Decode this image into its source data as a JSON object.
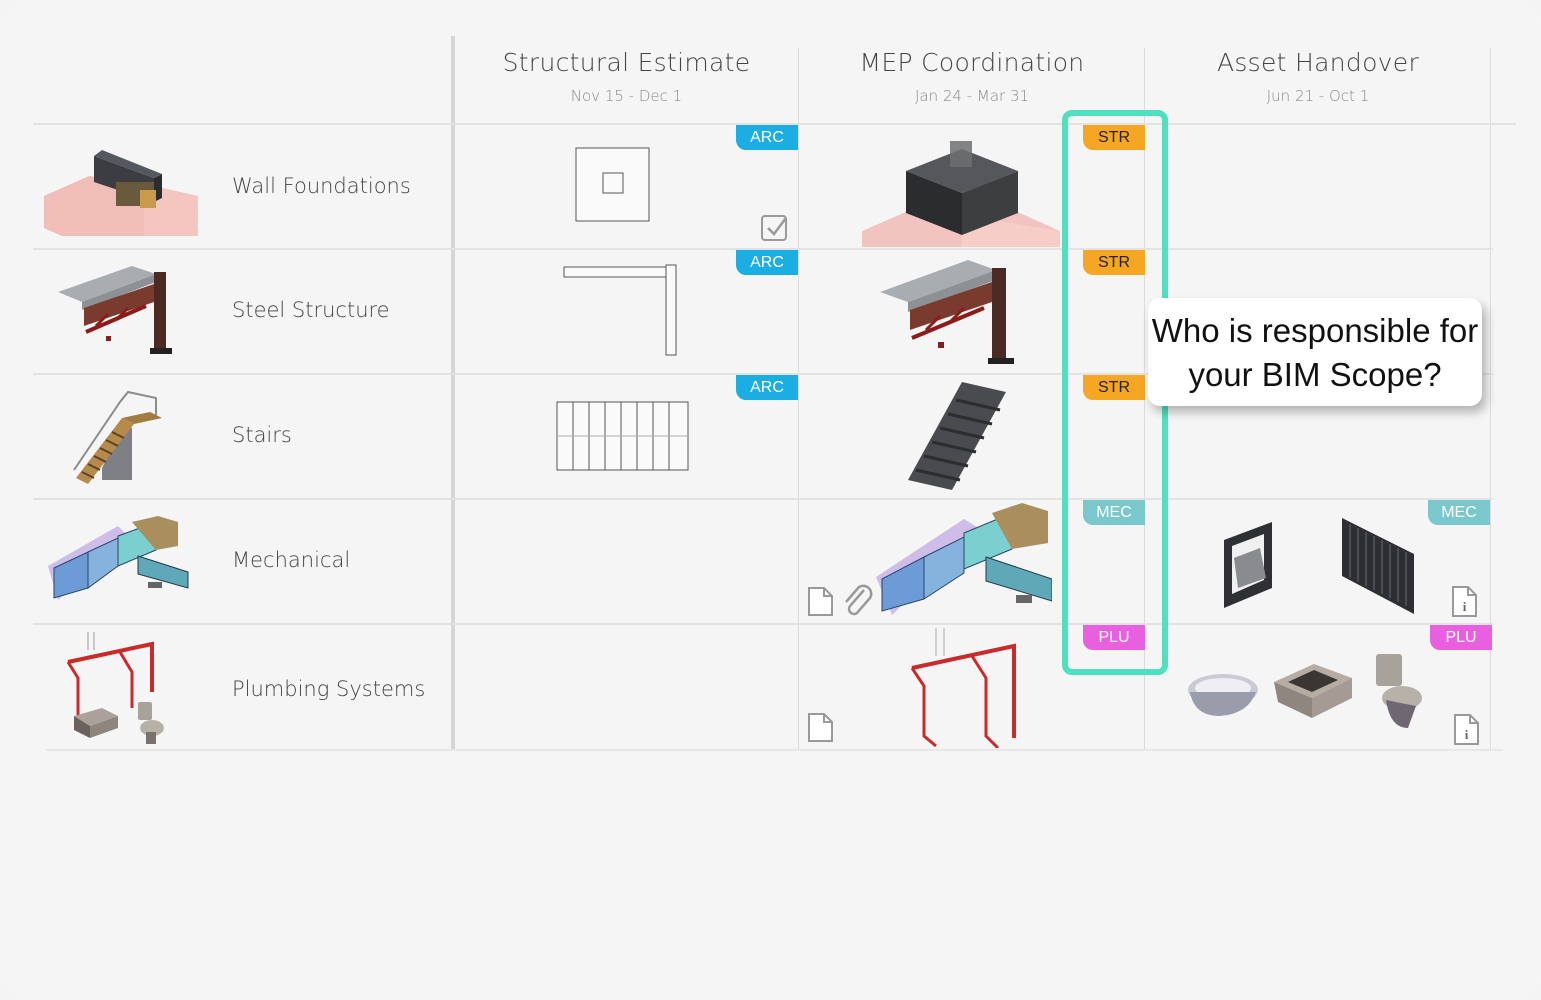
{
  "columns": [
    {
      "title": "Structural Estimate",
      "dates": "Nov 15 - Dec 1"
    },
    {
      "title": "MEP Coordination",
      "dates": "Jan 24 - Mar 31"
    },
    {
      "title": "Asset Handover",
      "dates": "Jun 21 - Oct 1"
    }
  ],
  "rows": [
    {
      "label": "Wall Foundations",
      "thumbnail": "wall-foundation-3d"
    },
    {
      "label": "Steel Structure",
      "thumbnail": "steel-structure-3d"
    },
    {
      "label": "Stairs",
      "thumbnail": "stairs-3d"
    },
    {
      "label": "Mechanical",
      "thumbnail": "duct-system-3d"
    },
    {
      "label": "Plumbing Systems",
      "thumbnail": "plumbing-fixtures-3d"
    }
  ],
  "tags": {
    "arc": "ARC",
    "str": "STR",
    "mec": "MEC",
    "plu": "PLU"
  },
  "colors": {
    "arc": "#1aaee3",
    "str": "#f5a623",
    "mec": "#7ac8cc",
    "plu": "#e85fe0",
    "highlight": "#4fe0c0"
  },
  "callout": {
    "line1": "Who is responsible for",
    "line2": "your BIM Scope?"
  },
  "icons": {
    "checkbox": "checkbox-checked-icon",
    "document": "document-icon",
    "attachment": "paperclip-icon",
    "info": "info-document-icon"
  }
}
